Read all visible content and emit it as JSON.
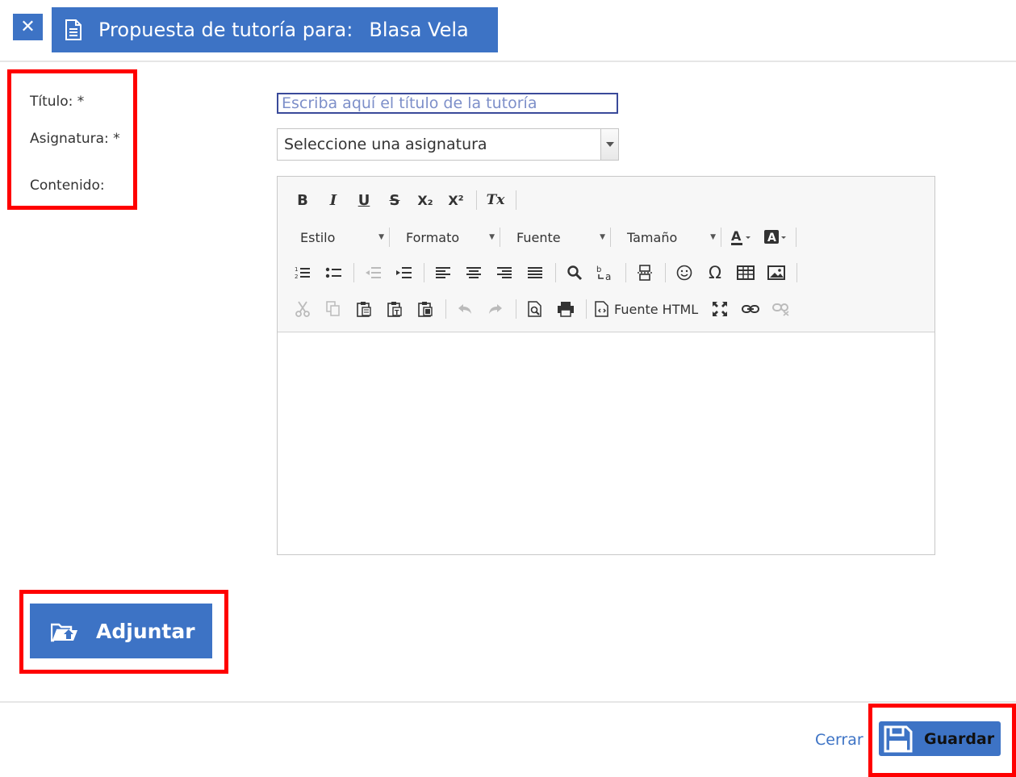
{
  "header": {
    "close_symbol": "✕",
    "title": "Propuesta de tutoría para:",
    "recipient": "Blasa Vela",
    "icon": "document-icon",
    "color": "#3d73c5"
  },
  "form": {
    "title_label": "Título: *",
    "subject_label": "Asignatura: *",
    "content_label": "Contenido:",
    "title_placeholder": "Escriba aquí el título de la tutoría",
    "subject_selected": "Seleccione una asignatura"
  },
  "editor": {
    "row1": [
      "B",
      "I",
      "U",
      "S",
      "X₂",
      "X²",
      "Tx"
    ],
    "combos": {
      "style": "Estilo",
      "format": "Formato",
      "font": "Fuente",
      "size": "Tamaño"
    },
    "source_label": "Fuente HTML"
  },
  "actions": {
    "attach_label": "Adjuntar",
    "close_label": "Cerrar",
    "save_label": "Guardar"
  },
  "highlight_color": "#ff0000"
}
